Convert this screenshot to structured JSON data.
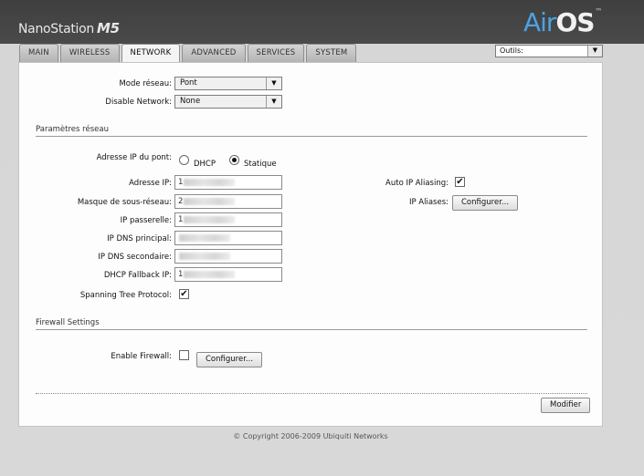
{
  "header": {
    "brand": "NanoStation",
    "model": "M5",
    "logo_air": "Air",
    "logo_os": "OS",
    "logo_tm": "™",
    "tools": {
      "selected": "Outils:"
    }
  },
  "tabs": [
    {
      "label": "MAIN"
    },
    {
      "label": "WIRELESS"
    },
    {
      "label": "NETWORK",
      "active": true
    },
    {
      "label": "ADVANCED"
    },
    {
      "label": "SERVICES"
    },
    {
      "label": "SYSTEM"
    }
  ],
  "top": {
    "mode_label": "Mode réseau:",
    "mode_value": "Pont",
    "disable_label": "Disable Network:",
    "disable_value": "None"
  },
  "network": {
    "section_title": "Paramètres réseau",
    "ip_type_label": "Adresse IP du pont:",
    "dhcp_label": "DHCP",
    "static_label": "Statique",
    "ip_type_selected": "Statique",
    "fields": {
      "ip": "Adresse IP:",
      "mask": "Masque de sous-réseau:",
      "gateway": "IP passerelle:",
      "dns1": "IP DNS principal:",
      "dns2": "IP DNS secondaire:",
      "fallback": "DHCP Fallback IP:"
    },
    "values": {
      "ip": "1",
      "mask": "2",
      "gateway": "1",
      "dns1": "",
      "dns2": "",
      "fallback": "1"
    },
    "stp_label": "Spanning Tree Protocol:",
    "stp_checked": true,
    "auto_alias_label": "Auto IP Aliasing:",
    "auto_alias_checked": true,
    "aliases_label": "IP Aliases:",
    "configure_label": "Configurer..."
  },
  "firewall": {
    "section_title": "Firewall Settings",
    "enable_label": "Enable Firewall:",
    "enable_checked": false,
    "configure_label": "Configurer..."
  },
  "actions": {
    "modify_label": "Modifier"
  },
  "footer": {
    "copyright": "© Copyright 2006-2009 Ubiquiti Networks"
  },
  "colors": {
    "accent_blue": "#4aa3e6",
    "header_dark": "#3f3f3f",
    "page_bg": "#d6d6d6"
  }
}
